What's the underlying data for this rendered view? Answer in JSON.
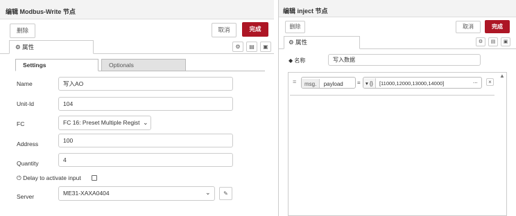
{
  "left": {
    "title": "编辑 Modbus-Write 节点",
    "delete_label": "删除",
    "cancel_label": "取消",
    "done_label": "完成",
    "tab_props": "属性",
    "subtab_settings": "Settings",
    "subtab_optionals": "Optionals",
    "fields": {
      "name": {
        "label": "Name",
        "value": "写入AO"
      },
      "unitid": {
        "label": "Unit-Id",
        "value": "104"
      },
      "fc": {
        "label": "FC",
        "value": "FC 16: Preset Multiple Regist"
      },
      "address": {
        "label": "Address",
        "value": "100"
      },
      "quantity": {
        "label": "Quantity",
        "value": "4"
      },
      "delay": {
        "label": "Delay to activate input",
        "checked": false
      },
      "server": {
        "label": "Server",
        "value": "ME31-XAXA0404"
      }
    }
  },
  "right": {
    "title": "编辑 inject 节点",
    "delete_label": "删除",
    "cancel_label": "取消",
    "done_label": "完成",
    "tab_props": "属性",
    "name_label": "名称",
    "name_value": "写入数据",
    "row": {
      "prefix": "msg.",
      "prop": "payload",
      "equals": "=",
      "type_label": "{}",
      "value": "[11000,12000,13000,14000]",
      "more": "...",
      "remove": "×"
    }
  },
  "colors": {
    "primary": "#ad1625",
    "border": "#cccccc",
    "header_bg": "#f3f3f3"
  }
}
